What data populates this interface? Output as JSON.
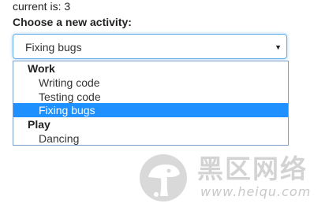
{
  "status": {
    "current_text": "current is: 3"
  },
  "form": {
    "label": "Choose a new activity:",
    "select": {
      "value": "Fixing bugs",
      "arrow_icon": "triangle-down-icon"
    }
  },
  "dropdown": {
    "groups": [
      {
        "label": "Work",
        "options": [
          "Writing code",
          "Testing code",
          "Fixing bugs"
        ]
      },
      {
        "label": "Play",
        "options": [
          "Dancing"
        ]
      }
    ],
    "selected_option": "Fixing bugs",
    "highlight_color": "#1e90ff"
  },
  "watermark": {
    "title": "黑区网络",
    "url": "www.heiqu.com",
    "logo_icon": "mushroom-logo-icon"
  }
}
